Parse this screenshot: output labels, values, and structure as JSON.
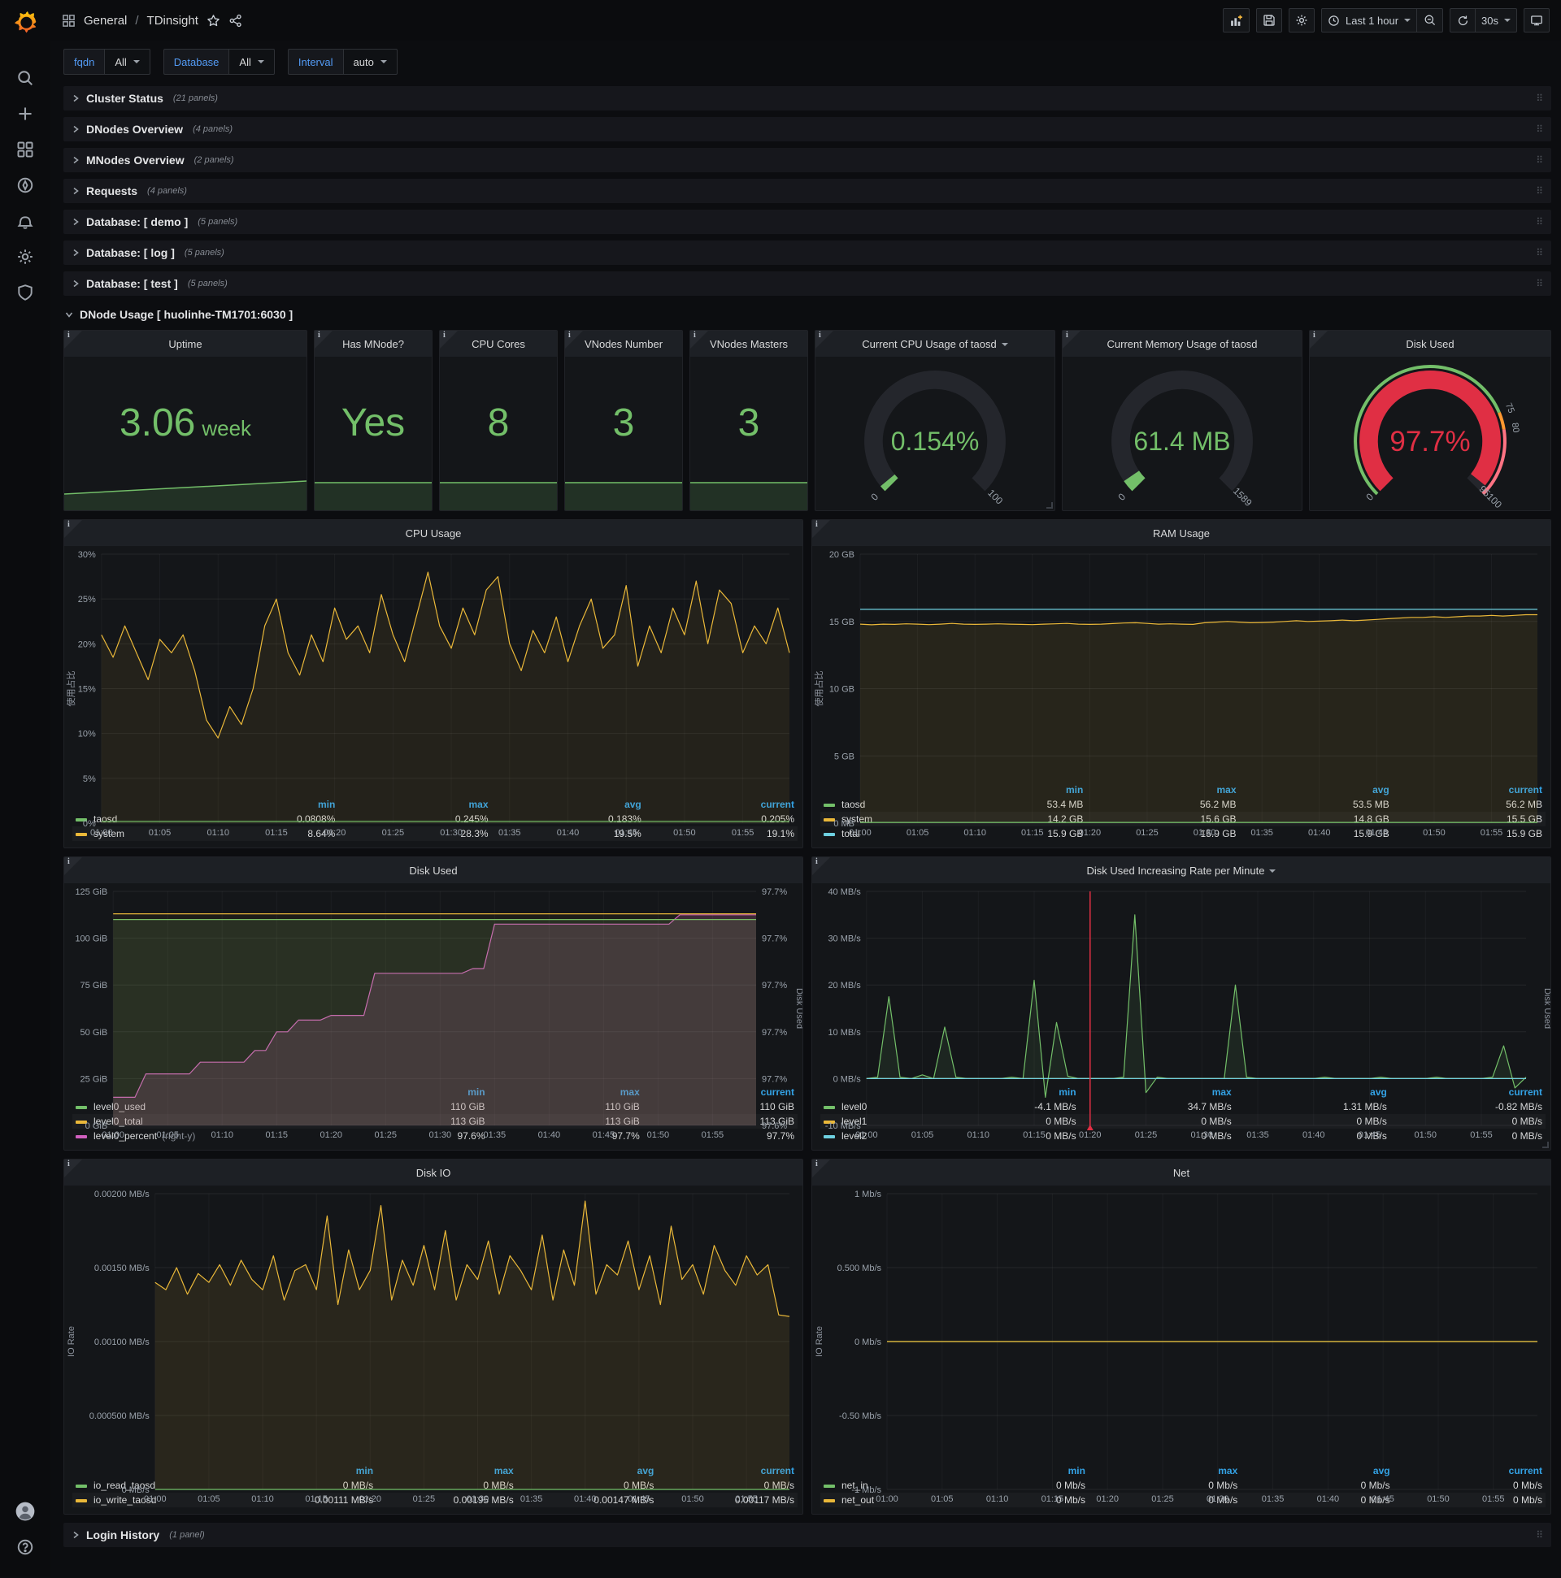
{
  "nav": {
    "breadcrumb_root": "General",
    "breadcrumb_sep": "/",
    "breadcrumb_title": "TDinsight",
    "time_range": "Last 1 hour",
    "refresh_interval": "30s"
  },
  "variables": [
    {
      "label": "fqdn",
      "value": "All"
    },
    {
      "label": "Database",
      "value": "All"
    },
    {
      "label": "Interval",
      "value": "auto"
    }
  ],
  "rows": [
    {
      "title": "Cluster Status",
      "count": "(21 panels)"
    },
    {
      "title": "DNodes Overview",
      "count": "(4 panels)"
    },
    {
      "title": "MNodes Overview",
      "count": "(2 panels)"
    },
    {
      "title": "Requests",
      "count": "(4 panels)"
    },
    {
      "title": "Database: [ demo ]",
      "count": "(5 panels)"
    },
    {
      "title": "Database: [ log ]",
      "count": "(5 panels)"
    },
    {
      "title": "Database: [ test ]",
      "count": "(5 panels)"
    }
  ],
  "expanded_row": {
    "title": "DNode Usage [ huolinhe-TM1701:6030 ]"
  },
  "login_row": {
    "title": "Login History",
    "count": "(1 panel)"
  },
  "colors": {
    "green": "#73bf69",
    "yellow": "#eab839",
    "cyan": "#6ed0e0",
    "magenta": "#cf5fbe",
    "red": "#e02f44",
    "orange": "#ff9830",
    "light_red": "#ff7383",
    "legend_header": "#33a2e5"
  },
  "stats": [
    {
      "title": "Uptime",
      "value": "3.06",
      "suffix": "week",
      "spark": [
        26,
        10
      ]
    },
    {
      "title": "Has MNode?",
      "value": "Yes",
      "suffix": "",
      "spark": [
        12,
        12
      ]
    },
    {
      "title": "CPU Cores",
      "value": "8",
      "suffix": "",
      "spark": [
        12,
        12
      ]
    },
    {
      "title": "VNodes Number",
      "value": "3",
      "suffix": "",
      "spark": [
        12,
        12
      ]
    },
    {
      "title": "VNodes Masters",
      "value": "3",
      "suffix": "",
      "spark": [
        12,
        12
      ]
    }
  ],
  "gauges": [
    {
      "title": "Current CPU Usage of taosd",
      "dropdown": true,
      "value": "0.154%",
      "value_color": "#73bf69",
      "arc_color": "#73bf69",
      "fraction": 0.02,
      "min_label": "0",
      "max_label": "100",
      "thresholds": null,
      "threshold_labels": []
    },
    {
      "title": "Current Memory Usage of taosd",
      "dropdown": false,
      "value": "61.4 MB",
      "value_color": "#73bf69",
      "arc_color": "#73bf69",
      "fraction": 0.039,
      "min_label": "0",
      "max_label": "1589",
      "thresholds": null,
      "threshold_labels": []
    },
    {
      "title": "Disk Used",
      "dropdown": false,
      "value": "97.7%",
      "value_color": "#e02f44",
      "arc_color": "#e02f44",
      "fraction": 0.977,
      "min_label": "0",
      "max_label": "95100",
      "thresholds": [
        {
          "to": 0.75,
          "color": "#73bf69"
        },
        {
          "to": 0.8,
          "color": "#ff9830"
        },
        {
          "to": 1.0,
          "color": "#ff7383"
        }
      ],
      "threshold_labels": [
        {
          "t": 0.75,
          "text": "75"
        },
        {
          "t": 0.8,
          "text": "80"
        }
      ]
    }
  ],
  "chart_data": [
    {
      "id": "cpu",
      "type": "line",
      "title": "CPU Usage",
      "ylabel": "使用占比",
      "ylim": [
        0,
        30
      ],
      "yticks": [
        "0%",
        "5%",
        "10%",
        "15%",
        "20%",
        "25%",
        "30%"
      ],
      "xticks": [
        "01:00",
        "01:05",
        "01:10",
        "01:15",
        "01:20",
        "01:25",
        "01:30",
        "01:35",
        "01:40",
        "01:45",
        "01:50",
        "01:55"
      ],
      "series": [
        {
          "name": "system",
          "color": "#eab839",
          "fill": 0.08,
          "data": [
            21,
            18.5,
            22,
            19,
            16,
            20.5,
            19,
            21,
            17,
            11.5,
            9.5,
            13,
            11,
            15,
            22,
            25,
            19,
            16.5,
            21,
            18,
            24,
            20.5,
            22,
            19,
            25.5,
            21,
            18,
            23,
            28,
            22,
            19.5,
            24,
            21,
            26,
            27.5,
            20,
            17,
            21.5,
            19,
            23,
            18,
            22,
            25,
            19.5,
            21,
            26.5,
            17.5,
            22,
            19,
            24,
            21,
            27,
            20,
            26,
            24.5,
            19,
            22,
            20,
            24,
            19
          ]
        },
        {
          "name": "taosd",
          "color": "#73bf69",
          "fill": 0.1,
          "const": 0.2
        }
      ],
      "legend": {
        "headers": [
          "min",
          "max",
          "avg",
          "current"
        ],
        "items": [
          {
            "label": "taosd",
            "color": "#73bf69",
            "values": [
              "0.0808%",
              "0.245%",
              "0.183%",
              "0.205%"
            ]
          },
          {
            "label": "system",
            "color": "#eab839",
            "values": [
              "8.64%",
              "28.3%",
              "19.5%",
              "19.1%"
            ]
          }
        ]
      }
    },
    {
      "id": "ram",
      "type": "line",
      "title": "RAM Usage",
      "ylabel": "使用占比",
      "ylim": [
        0,
        20
      ],
      "yticks": [
        "0 MB",
        "5 GB",
        "10 GB",
        "15 GB",
        "20 GB"
      ],
      "xticks": [
        "01:00",
        "01:05",
        "01:10",
        "01:15",
        "01:20",
        "01:25",
        "01:30",
        "01:35",
        "01:40",
        "01:45",
        "01:50",
        "01:55"
      ],
      "series": [
        {
          "name": "system",
          "color": "#eab839",
          "fill": 0.09,
          "data": [
            14.8,
            14.75,
            14.8,
            14.78,
            14.82,
            14.8,
            14.76,
            14.8,
            14.85,
            14.8,
            14.78,
            14.8,
            14.82,
            14.8,
            14.78,
            14.76,
            14.8,
            14.82,
            14.85,
            14.8,
            14.78,
            14.8,
            14.84,
            14.88,
            14.9,
            14.85,
            14.8,
            14.82,
            14.8,
            14.78,
            14.9,
            14.95,
            15.0,
            14.95,
            14.9,
            14.92,
            14.95,
            15.0,
            15.05,
            15.0,
            15.02,
            15.05,
            15.1,
            15.05,
            15.1,
            15.15,
            15.2,
            15.25,
            15.3,
            15.3,
            15.35,
            15.3,
            15.35,
            15.4,
            15.4,
            15.45,
            15.4,
            15.45,
            15.5,
            15.5
          ]
        },
        {
          "name": "total",
          "color": "#6ed0e0",
          "fill": 0,
          "const": 15.9
        },
        {
          "name": "taosd",
          "color": "#73bf69",
          "fill": 0.1,
          "const": 0.055
        }
      ],
      "legend": {
        "headers": [
          "min",
          "max",
          "avg",
          "current"
        ],
        "items": [
          {
            "label": "taosd",
            "color": "#73bf69",
            "values": [
              "53.4 MB",
              "56.2 MB",
              "53.5 MB",
              "56.2 MB"
            ]
          },
          {
            "label": "system",
            "color": "#eab839",
            "values": [
              "14.2 GB",
              "15.6 GB",
              "14.8 GB",
              "15.5 GB"
            ]
          },
          {
            "label": "total",
            "color": "#6ed0e0",
            "values": [
              "15.9 GB",
              "15.9 GB",
              "15.9 GB",
              "15.9 GB"
            ]
          }
        ]
      }
    },
    {
      "id": "disk_used",
      "type": "line",
      "title": "Disk Used",
      "ylim": [
        0,
        125
      ],
      "rylim": [
        0,
        1
      ],
      "rylabel": "Disk Used",
      "yticks": [
        "0 GiB",
        "25 GiB",
        "50 GiB",
        "75 GiB",
        "100 GiB",
        "125 GiB"
      ],
      "ryticks": [
        "97.6%",
        "97.7%",
        "97.7%",
        "97.7%",
        "97.7%",
        "97.7%"
      ],
      "xticks": [
        "01:00",
        "01:05",
        "01:10",
        "01:15",
        "01:20",
        "01:25",
        "01:30",
        "01:35",
        "01:40",
        "01:45",
        "01:50",
        "01:55"
      ],
      "series": [
        {
          "name": "level0_percent",
          "color": "#cf5fbe",
          "fill": 0.18,
          "axis": "r",
          "data": [
            0.12,
            0.12,
            0.12,
            0.22,
            0.22,
            0.22,
            0.22,
            0.22,
            0.27,
            0.27,
            0.27,
            0.27,
            0.27,
            0.32,
            0.32,
            0.4,
            0.4,
            0.45,
            0.45,
            0.45,
            0.47,
            0.47,
            0.47,
            0.47,
            0.65,
            0.65,
            0.65,
            0.65,
            0.65,
            0.65,
            0.65,
            0.65,
            0.65,
            0.67,
            0.67,
            0.86,
            0.86,
            0.86,
            0.86,
            0.86,
            0.86,
            0.86,
            0.86,
            0.86,
            0.86,
            0.86,
            0.86,
            0.86,
            0.86,
            0.86,
            0.86,
            0.86,
            0.9,
            0.9,
            0.9,
            0.9,
            0.9,
            0.9,
            0.9,
            0.9
          ]
        },
        {
          "name": "level0_used",
          "color": "#73bf69",
          "fill": 0.12,
          "const": 110
        },
        {
          "name": "level0_total",
          "color": "#eab839",
          "fill": 0.05,
          "const": 113
        }
      ],
      "legend": {
        "headers": [
          "min",
          "max",
          "current"
        ],
        "items": [
          {
            "label": "level0_used",
            "color": "#73bf69",
            "values": [
              "110 GiB",
              "110 GiB",
              "110 GiB"
            ]
          },
          {
            "label": "level0_total",
            "color": "#eab839",
            "values": [
              "113 GiB",
              "113 GiB",
              "113 GiB"
            ]
          },
          {
            "label": "level0_percent",
            "note": "(right-y)",
            "color": "#cf5fbe",
            "values": [
              "97.6%",
              "97.7%",
              "97.7%"
            ]
          }
        ]
      }
    },
    {
      "id": "disk_rate",
      "type": "line",
      "title": "Disk Used Increasing Rate per Minute",
      "dropdown": true,
      "ylim": [
        -10,
        40
      ],
      "rylabel": "Disk Used",
      "yticks": [
        "-10 MB/s",
        "0 MB/s",
        "10 MB/s",
        "20 MB/s",
        "30 MB/s",
        "40 MB/s"
      ],
      "xticks": [
        "01:00",
        "01:05",
        "01:10",
        "01:15",
        "01:20",
        "01:25",
        "01:30",
        "01:35",
        "01:40",
        "01:45",
        "01:50",
        "01:55"
      ],
      "annotation": 0.339,
      "series": [
        {
          "name": "level0",
          "color": "#73bf69",
          "fill": 0.1,
          "data": [
            0,
            0.3,
            17.5,
            0.3,
            0,
            0.8,
            0,
            11,
            0.3,
            0,
            0,
            0,
            0,
            0.3,
            0,
            21,
            -4,
            12,
            0.5,
            0,
            0,
            0,
            0,
            0.3,
            35,
            -3,
            0.3,
            0,
            0,
            0,
            0,
            0,
            0,
            20,
            0.3,
            0,
            0,
            0,
            0,
            0,
            0,
            0.3,
            0,
            0,
            0,
            0,
            0.3,
            0,
            0,
            0,
            0,
            0.3,
            0,
            0,
            0,
            0,
            0.3,
            7,
            -2,
            0.3
          ]
        },
        {
          "name": "level1",
          "color": "#eab839",
          "fill": 0,
          "const": 0
        },
        {
          "name": "level2",
          "color": "#6ed0e0",
          "fill": 0,
          "const": 0
        }
      ],
      "legend": {
        "headers": [
          "min",
          "max",
          "avg",
          "current"
        ],
        "items": [
          {
            "label": "level0",
            "color": "#73bf69",
            "values": [
              "-4.1 MB/s",
              "34.7 MB/s",
              "1.31 MB/s",
              "-0.82 MB/s"
            ]
          },
          {
            "label": "level1",
            "color": "#eab839",
            "values": [
              "0 MB/s",
              "0 MB/s",
              "0 MB/s",
              "0 MB/s"
            ]
          },
          {
            "label": "level2",
            "color": "#6ed0e0",
            "values": [
              "0 MB/s",
              "0 MB/s",
              "0 MB/s",
              "0 MB/s"
            ]
          }
        ]
      }
    },
    {
      "id": "disk_io",
      "type": "line",
      "title": "Disk IO",
      "ylabel": "IO Rate",
      "ylim": [
        0,
        0.002
      ],
      "yticks": [
        "0 MB/s",
        "0.000500 MB/s",
        "0.00100 MB/s",
        "0.00150 MB/s",
        "0.00200 MB/s"
      ],
      "xticks": [
        "01:00",
        "01:05",
        "01:10",
        "01:15",
        "01:20",
        "01:25",
        "01:30",
        "01:35",
        "01:40",
        "01:45",
        "01:50",
        "01:55"
      ],
      "series": [
        {
          "name": "io_write_taosd",
          "color": "#eab839",
          "fill": 0.1,
          "data": [
            0.0014,
            0.00135,
            0.0015,
            0.00132,
            0.00146,
            0.0014,
            0.00152,
            0.00138,
            0.00155,
            0.00142,
            0.00135,
            0.00158,
            0.00128,
            0.00148,
            0.00152,
            0.00135,
            0.00185,
            0.00125,
            0.00162,
            0.00135,
            0.00148,
            0.00192,
            0.00128,
            0.00155,
            0.00138,
            0.00165,
            0.00135,
            0.00175,
            0.00128,
            0.00152,
            0.00142,
            0.00168,
            0.00132,
            0.00158,
            0.00148,
            0.00135,
            0.00172,
            0.00128,
            0.00162,
            0.00138,
            0.00195,
            0.00132,
            0.00152,
            0.00145,
            0.00168,
            0.00135,
            0.00158,
            0.00125,
            0.00178,
            0.00142,
            0.00152,
            0.00132,
            0.00165,
            0.00148,
            0.00138,
            0.00158,
            0.00145,
            0.00152,
            0.00118,
            0.00117
          ]
        },
        {
          "name": "io_read_taosd",
          "color": "#73bf69",
          "fill": 0.1,
          "const": 0
        }
      ],
      "legend": {
        "headers": [
          "min",
          "max",
          "avg",
          "current"
        ],
        "items": [
          {
            "label": "io_read_taosd",
            "color": "#73bf69",
            "values": [
              "0 MB/s",
              "0 MB/s",
              "0 MB/s",
              "0 MB/s"
            ]
          },
          {
            "label": "io_write_taosd",
            "color": "#eab839",
            "values": [
              "0.00111 MB/s",
              "0.00195 MB/s",
              "0.00147 MB/s",
              "0.00117 MB/s"
            ]
          }
        ]
      }
    },
    {
      "id": "net",
      "type": "line",
      "title": "Net",
      "ylabel": "IO Rate",
      "ylim": [
        -1,
        1
      ],
      "yticks": [
        "-1 Mb/s",
        "-0.50 Mb/s",
        "0 Mb/s",
        "0.500 Mb/s",
        "1 Mb/s"
      ],
      "xticks": [
        "01:00",
        "01:05",
        "01:10",
        "01:15",
        "01:20",
        "01:25",
        "01:30",
        "01:35",
        "01:40",
        "01:45",
        "01:50",
        "01:55"
      ],
      "series": [
        {
          "name": "net_in",
          "color": "#73bf69",
          "fill": 0,
          "const": 0
        },
        {
          "name": "net_out",
          "color": "#eab839",
          "fill": 0,
          "const": 0
        }
      ],
      "legend": {
        "headers": [
          "min",
          "max",
          "avg",
          "current"
        ],
        "items": [
          {
            "label": "net_in",
            "color": "#73bf69",
            "values": [
              "0 Mb/s",
              "0 Mb/s",
              "0 Mb/s",
              "0 Mb/s"
            ]
          },
          {
            "label": "net_out",
            "color": "#eab839",
            "values": [
              "0 Mb/s",
              "0 Mb/s",
              "0 Mb/s",
              "0 Mb/s"
            ]
          }
        ]
      }
    }
  ]
}
